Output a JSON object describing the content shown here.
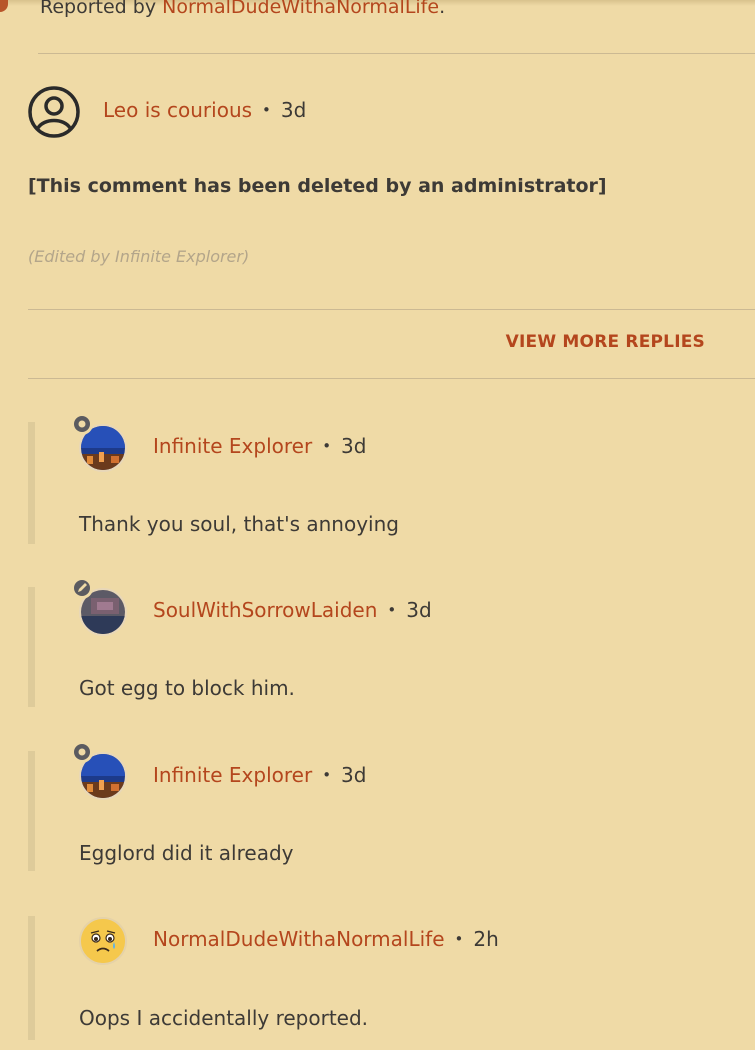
{
  "top_report": {
    "prefix": "Reported by ",
    "user": "NormalDudeWithaNormalLife",
    "suffix": "."
  },
  "main_comment": {
    "avatar_icon": "user-circle-icon",
    "username": "Leo is courious",
    "separator": "•",
    "age": "3d",
    "body": "[This comment has been deleted by an administrator]",
    "edited_note": "(Edited by Infinite Explorer)"
  },
  "view_more_label": "VIEW MORE REPLIES",
  "replies": [
    {
      "username": "Infinite Explorer",
      "separator": "•",
      "age": "3d",
      "text": "Thank you soul, that's annoying",
      "badge_icon": "gear-badge-icon"
    },
    {
      "username": "SoulWithSorrowLaiden",
      "separator": "•",
      "age": "3d",
      "text": "Got egg to block him.",
      "badge_icon": "pencil-badge-icon"
    },
    {
      "username": "Infinite Explorer",
      "separator": "•",
      "age": "3d",
      "text": "Egglord did it already",
      "badge_icon": "gear-badge-icon"
    },
    {
      "username": "NormalDudeWithaNormalLife",
      "separator": "•",
      "age": "2h",
      "text": "Oops I accidentally reported.",
      "badge_icon": ""
    }
  ],
  "colors": {
    "background": "#efdaa6",
    "accent": "#b4461d",
    "text": "#3d3a36",
    "muted": "#b3a58a"
  }
}
